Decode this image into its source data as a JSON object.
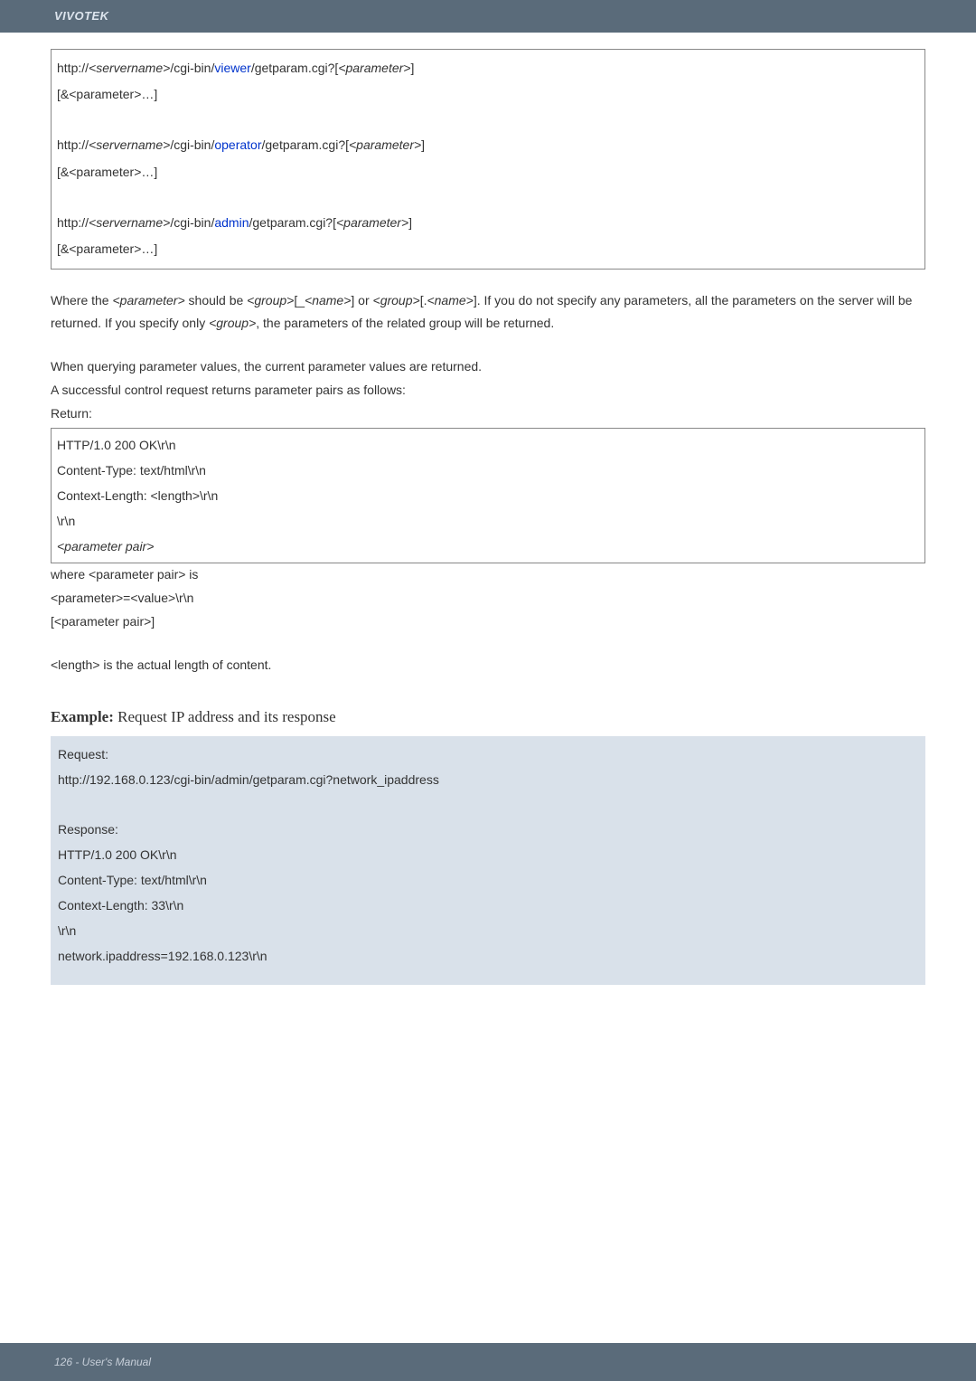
{
  "header": {
    "brand": "VIVOTEK"
  },
  "syntax_box": {
    "l1a": "http://",
    "l1b": "<servername>",
    "l1c": "/cgi-bin/",
    "l1d": "viewer",
    "l1e": "/getparam.cgi?[",
    "l1f": "<parameter>",
    "l1g": "]",
    "l2": "[&<parameter>…]",
    "l3a": "http://",
    "l3b": "<servername>",
    "l3c": "/cgi-bin/",
    "l3d": "operator",
    "l3e": "/getparam.cgi?[",
    "l3f": "<parameter>",
    "l3g": "]",
    "l4": "[&<parameter>…]",
    "l5a": "http://",
    "l5b": "<servername>",
    "l5c": "/cgi-bin/",
    "l5d": "admin",
    "l5e": "/getparam.cgi?[",
    "l5f": "<parameter>",
    "l5g": "]",
    "l6": "[&<parameter>…]"
  },
  "desc": {
    "p1a": "Where the ",
    "p1b": "<parameter>",
    "p1c": " should be ",
    "p1d": "<group>",
    "p1e": "[_",
    "p1f": "<name>",
    "p1g": "] or ",
    "p1h": "<group>",
    "p1i": "[.",
    "p1j": "<name>",
    "p1k": "]. If you do not specify any parameters, all the parameters on the server will be returned. If you specify only ",
    "p1l": "<group>",
    "p1m": ", the parameters of the related group will be returned.",
    "p2": "When querying parameter values, the current parameter values are returned.",
    "p3": "A successful control request returns parameter pairs as follows:",
    "return_label": "Return:"
  },
  "return_box": {
    "r1": "HTTP/1.0 200 OK\\r\\n",
    "r2": "Content-Type: text/html\\r\\n",
    "r3": "Context-Length: <length>\\r\\n",
    "r4": "\\r\\n",
    "r5": "<parameter pair>"
  },
  "after_return": {
    "a1": "where <parameter pair> is",
    "a2": "<parameter>=<value>\\r\\n",
    "a3": "[<parameter pair>]",
    "a4": "<length> is the actual length of content."
  },
  "example": {
    "label_bold": "Example:",
    "label_rest": " Request IP address and its response",
    "req_label": "Request:",
    "req_url": "http://192.168.0.123/cgi-bin/admin/getparam.cgi?network_ipaddress",
    "resp_label": "Response:",
    "resp1": "HTTP/1.0 200 OK\\r\\n",
    "resp2": "Content-Type: text/html\\r\\n",
    "resp3": "Context-Length: 33\\r\\n",
    "resp4": "\\r\\n",
    "resp5": "network.ipaddress=192.168.0.123\\r\\n"
  },
  "footer": {
    "text": "126 - User's Manual"
  }
}
